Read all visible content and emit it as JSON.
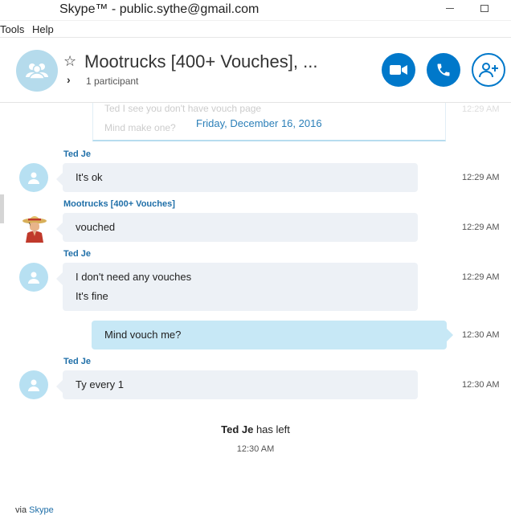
{
  "window": {
    "title": "Skype™ - public.sythe@gmail.com"
  },
  "menu": {
    "tools": "Tools",
    "help": "Help"
  },
  "conversation": {
    "title": "Mootrucks [400+ Vouches], ...",
    "participants": "1 participant"
  },
  "faded_messages": [
    "Ted I see you don't have vouch page",
    "Mind make one?"
  ],
  "faded_time": "12:29 AM",
  "date_separator": "Friday, December 16, 2016",
  "messages": [
    {
      "sender": "Ted Je",
      "lines": [
        "It's ok"
      ],
      "time": "12:29 AM"
    },
    {
      "sender": "Mootrucks [400+ Vouches]",
      "lines": [
        "vouched"
      ],
      "time": "12:29 AM"
    },
    {
      "sender": "Ted Je",
      "lines": [
        "I don't need any vouches",
        "It's fine"
      ],
      "time": "12:29 AM"
    },
    {
      "sender": "",
      "lines": [
        "Mind vouch me?"
      ],
      "time": "12:30 AM"
    },
    {
      "sender": "Ted Je",
      "lines": [
        "Ty every 1"
      ],
      "time": "12:30 AM"
    }
  ],
  "event": {
    "name": "Ted Je",
    "text": " has left",
    "time": "12:30 AM"
  },
  "footer": {
    "via": "via",
    "brand": "Skype"
  },
  "colors": {
    "accent": "#0078ca",
    "link": "#1f6fa8",
    "bubble": "#edf1f6",
    "own_bubble": "#c7e8f6",
    "avatar": "#b7e0f2"
  }
}
